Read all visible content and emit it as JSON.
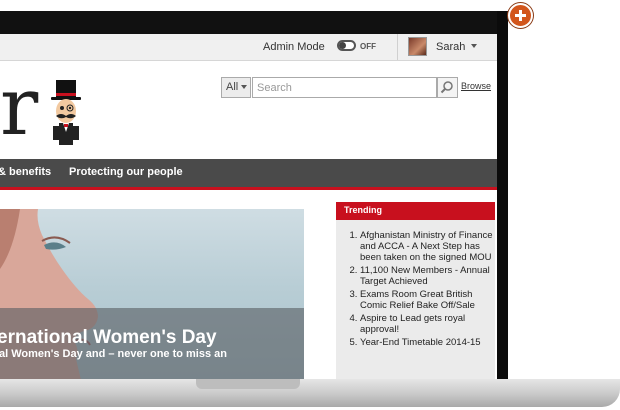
{
  "topbar": {
    "admin_mode_label": "Admin Mode",
    "admin_mode_state": "OFF",
    "user_name": "Sarah"
  },
  "search": {
    "scope": "All",
    "placeholder": "Search",
    "browse_label": "Browse"
  },
  "nav": {
    "items": [
      {
        "label": "& benefits"
      },
      {
        "label": "Protecting our people"
      }
    ]
  },
  "hero": {
    "title": "ernational Women's Day",
    "subtitle": "al Women's Day and – never one to miss an"
  },
  "trending": {
    "title": "Trending",
    "items": [
      "Afghanistan Ministry of Finance and ACCA - A Next Step has been taken on the signed MOU",
      "11,100 New Members - Annual Target Achieved",
      "Exams Room Great British Comic Relief Bake Off/Sale",
      "Aspire to Lead gets royal approval!",
      "Year-End Timetable 2014-15"
    ]
  },
  "logo": {
    "letter": "r"
  },
  "colors": {
    "accent": "#c8101e",
    "nav_bg": "#4a4a4a",
    "plus_button": "#d2561c"
  },
  "icons": {
    "plus": "plus-icon",
    "search": "magnifier-icon",
    "mascot": "monocle-gentleman-mascot"
  }
}
